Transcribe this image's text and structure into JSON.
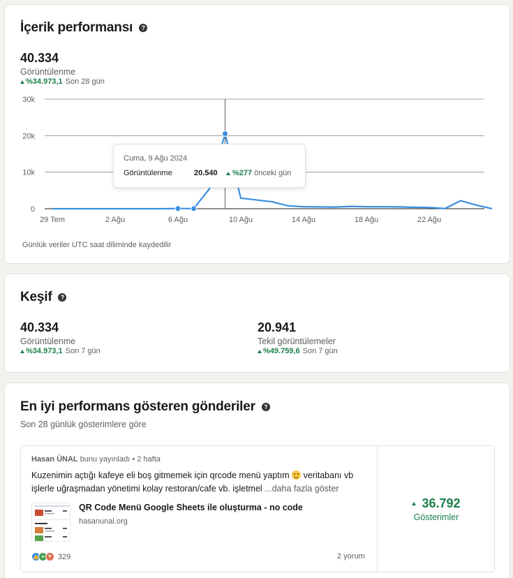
{
  "content_performance": {
    "title": "İçerik performansı",
    "help_icon": "help-icon",
    "metric_value": "40.334",
    "metric_label": "Görüntülenme",
    "trend_pct": "%34.973,1",
    "trend_period": "Son 28 gün",
    "footnote": "Günlük veriler UTC saat diliminde kaydedilir",
    "tooltip": {
      "date": "Cuma, 9 Ağu 2024",
      "label": "Görüntülenme",
      "value": "20.540",
      "pct": "%277",
      "suffix": "önceki gün"
    }
  },
  "chart_data": {
    "type": "line",
    "title": "",
    "xlabel": "",
    "ylabel": "",
    "ylim": [
      0,
      30000
    ],
    "y_ticks": [
      "0",
      "10k",
      "20k",
      "30k"
    ],
    "x_tick_labels": [
      "29 Tem",
      "2 Ağu",
      "6 Ağu",
      "10 Ağu",
      "14 Ağu",
      "18 Ağu",
      "22 Ağu"
    ],
    "grid": true,
    "color": "#3b8fe0",
    "x": [
      "29 Tem",
      "30 Tem",
      "31 Tem",
      "1 Ağu",
      "2 Ağu",
      "3 Ağu",
      "4 Ağu",
      "5 Ağu",
      "6 Ağu",
      "7 Ağu",
      "8 Ağu",
      "9 Ağu",
      "10 Ağu",
      "11 Ağu",
      "12 Ağu",
      "13 Ağu",
      "14 Ağu",
      "15 Ağu",
      "16 Ağu",
      "17 Ağu",
      "18 Ağu",
      "19 Ağu",
      "20 Ağu",
      "21 Ağu",
      "22 Ağu",
      "23 Ağu",
      "24 Ağu",
      "25 Ağu",
      "26 Ağu"
    ],
    "values": [
      0,
      0,
      0,
      0,
      0,
      0,
      0,
      0,
      50,
      40,
      5445,
      20540,
      2900,
      2400,
      1900,
      800,
      550,
      500,
      450,
      650,
      550,
      550,
      500,
      400,
      350,
      50,
      2200,
      1000,
      0
    ],
    "highlight_points": [
      "6 Ağu",
      "7 Ağu",
      "9 Ağu"
    ],
    "hover_x": "9 Ağu"
  },
  "discovery": {
    "title": "Keşif",
    "help_icon": "help-icon",
    "metrics": [
      {
        "value": "40.334",
        "label": "Görüntülenme",
        "pct": "%34.973,1",
        "period": "Son 7 gün"
      },
      {
        "value": "20.941",
        "label": "Tekil görüntülemeler",
        "pct": "%49.759,6",
        "period": "Son 7 gün"
      }
    ]
  },
  "top_posts": {
    "title": "En iyi performans gösteren gönderiler",
    "help_icon": "help-icon",
    "subtitle": "Son 28 günlük gösterimlere göre",
    "post": {
      "author": "Hasan ÜNAL",
      "action": "bunu yayınladı",
      "time": "2 hafta",
      "text_part1": "Kuzenimin açtığı kafeye eli boş gitmemek için qrcode menü yaptım",
      "emoji": "grinning-face-emoji",
      "text_part2": "veritabanı vb işlerle uğraşmadan yönetimi kolay restoran/cafe vb. işletmel",
      "more": "...daha fazla göster",
      "link_title": "QR Code Menü Google Sheets ile oluşturma - no code",
      "link_domain": "hasanunal.org",
      "reaction_count": "329",
      "comments": "2 yorum",
      "impressions": "36.792",
      "impressions_label": "Gösterimler"
    }
  }
}
